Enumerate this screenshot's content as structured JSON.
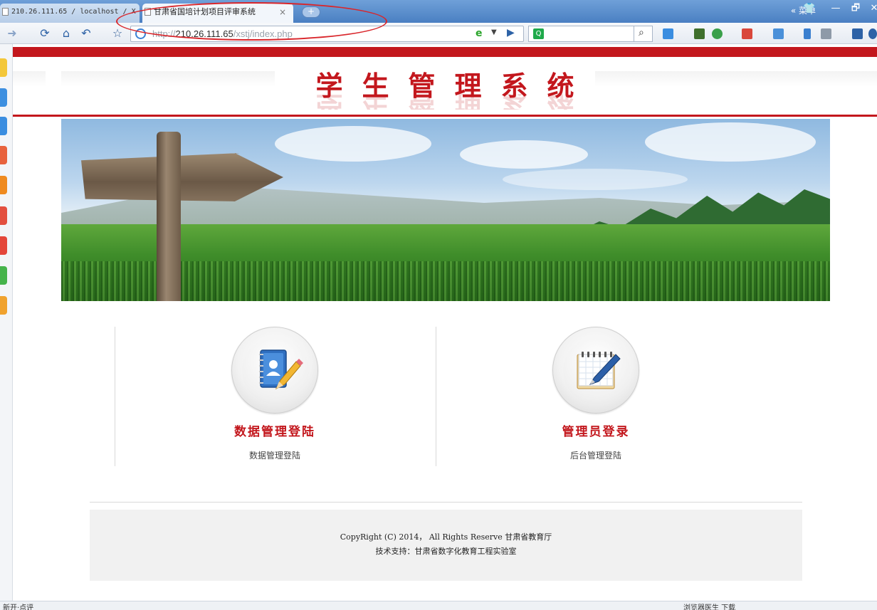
{
  "browser": {
    "tabs": [
      {
        "label": "210.26.111.65 / localhost / X"
      },
      {
        "label": "甘肃省国培计划项目评审系统",
        "close": "×"
      }
    ],
    "new_tab_label": "+",
    "menu_label": "« 菜单",
    "window_buttons": [
      "—",
      "🗗",
      "✕"
    ],
    "address": {
      "scheme": "http://",
      "host": "210.26.111.65",
      "path": "/xstj/index.php"
    },
    "search_placeholder": ""
  },
  "header": {
    "title": "学生管理系统"
  },
  "cards": [
    {
      "title": "数据管理登陆",
      "subtitle": "数据管理登陆",
      "icon": "address-book-pencil-icon"
    },
    {
      "title": "管理员登录",
      "subtitle": "后台管理登陆",
      "icon": "notepad-pen-icon"
    }
  ],
  "footer": {
    "copyright": "CopyRight (C) 2014， All Rights Reserve   甘肃省教育厅",
    "support": "技术支持：甘肃省数字化教育工程实验室"
  },
  "status": {
    "left_text": "新开·点评",
    "right_text": "浏览器医生   下载"
  },
  "colors": {
    "brand_red": "#c3171d",
    "annotation_red": "#d9262b",
    "chrome_blue": "#4a7fc2"
  }
}
